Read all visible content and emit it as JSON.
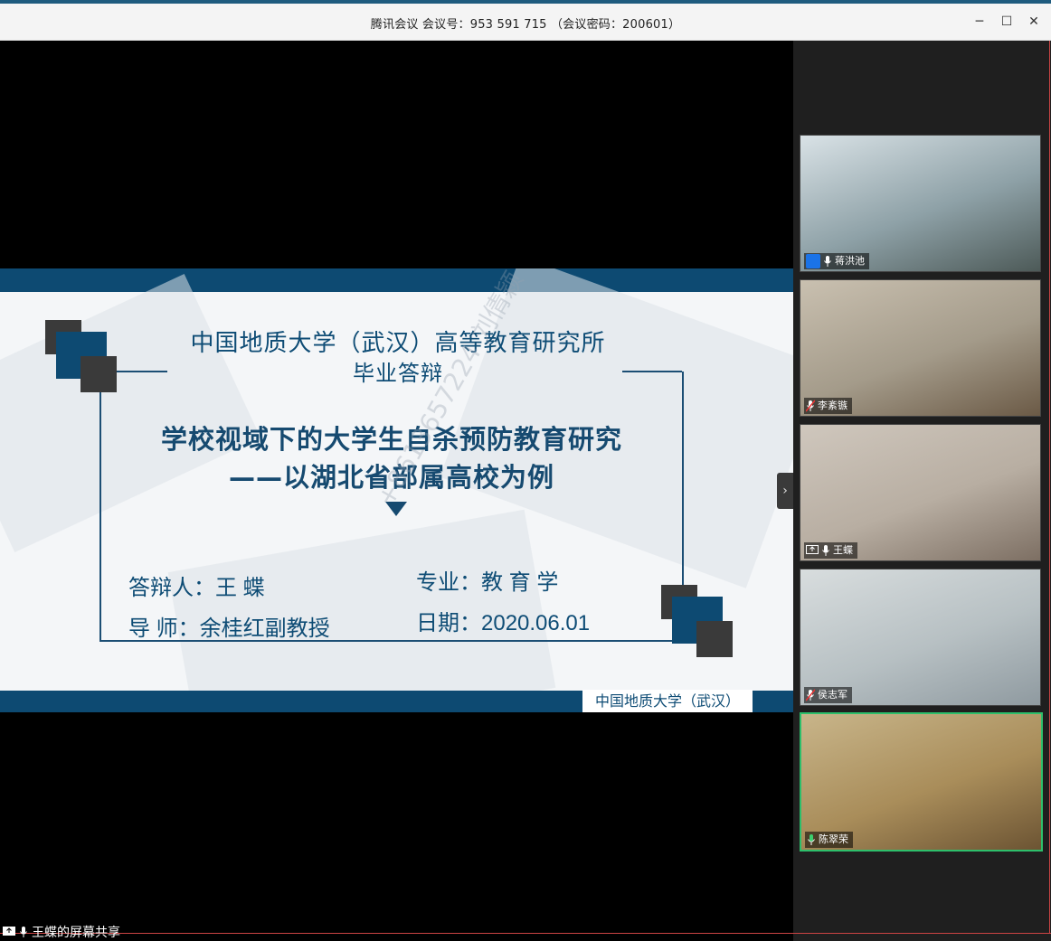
{
  "window": {
    "title": "腾讯会议 会议号：953 591 715 （会议密码：200601）",
    "controls": {
      "minimize": "─",
      "maximize": "☐",
      "close": "✕"
    }
  },
  "slide": {
    "institution": "中国地质大学（武汉）高等教育研究所",
    "subtitle": "毕业答辩",
    "title_line1": "学校视域下的大学生自杀预防教育研究",
    "title_line2": "——以湖北省部属高校为例",
    "defender": "答辩人：王  蝶",
    "advisor": "导  师：余桂红副教授",
    "major": "专业：教 育 学",
    "date": "日期：2020.06.01",
    "footer": "中国地质大学（武汉）",
    "watermark": "+8613657224 刘倩颖"
  },
  "participants": [
    {
      "name": "蒋洪池",
      "active": false,
      "colors": [
        "#d9e2e6",
        "#8ea1a7",
        "#4d5a58"
      ]
    },
    {
      "name": "李紊镞",
      "active": false,
      "colors": [
        "#c9c0b0",
        "#a49b8a",
        "#6b5a46"
      ]
    },
    {
      "name": "王蝶",
      "active": false,
      "colors": [
        "#cfc7bd",
        "#b8aea2",
        "#7d6f63"
      ]
    },
    {
      "name": "侯志军",
      "active": false,
      "colors": [
        "#d8ddde",
        "#b7c0c3",
        "#8f9aa0"
      ]
    },
    {
      "name": "陈翠荣",
      "active": true,
      "colors": [
        "#c8b58a",
        "#a98d5a",
        "#6c5433"
      ]
    }
  ],
  "side_toggle": "›",
  "share_status": "王蝶的屏幕共享"
}
